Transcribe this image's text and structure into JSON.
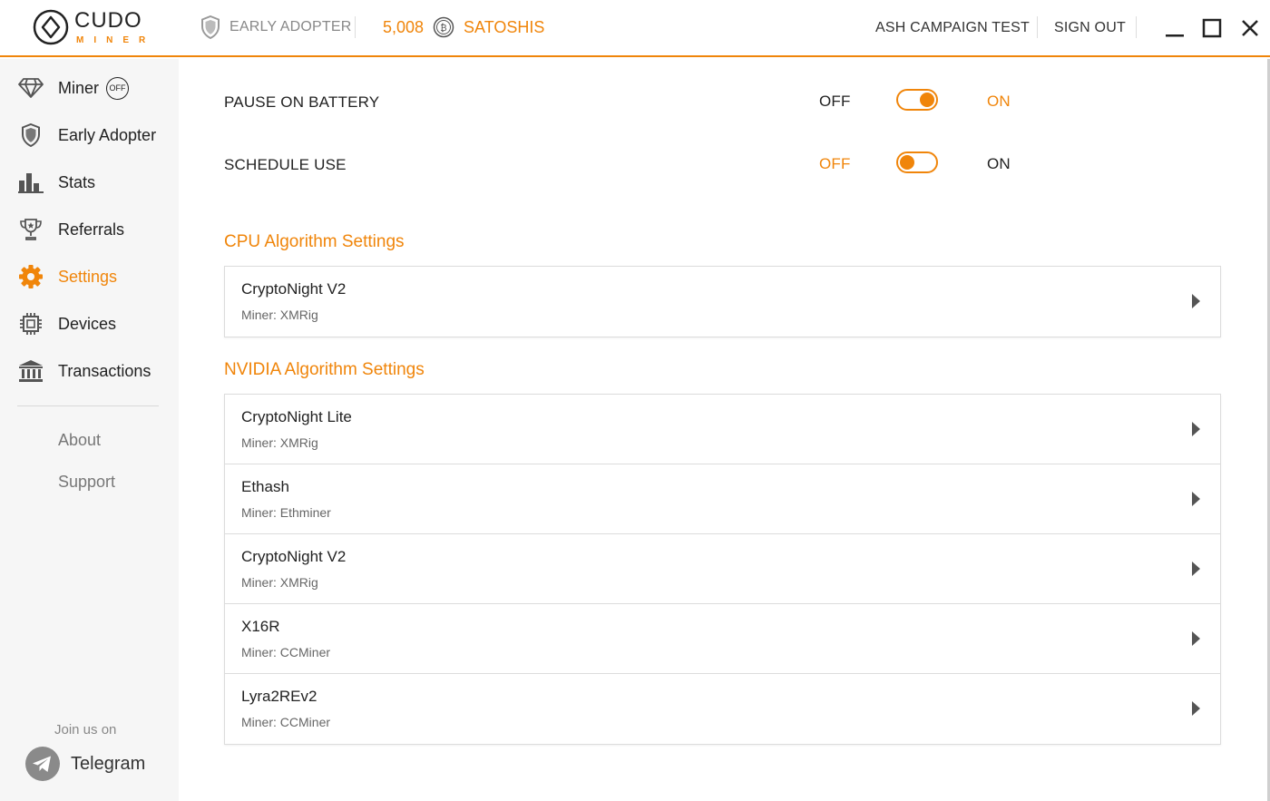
{
  "header": {
    "logo_word": "CUDO",
    "logo_sub": "MINER",
    "badge_label": "EARLY ADOPTER",
    "balance_value": "5,008",
    "balance_unit": "SATOSHIS",
    "campaign": "ASH CAMPAIGN TEST",
    "sign_out": "SIGN OUT"
  },
  "sidebar": {
    "items": [
      {
        "label": "Miner",
        "icon": "diamond-icon",
        "status": "OFF"
      },
      {
        "label": "Early Adopter",
        "icon": "shield-icon"
      },
      {
        "label": "Stats",
        "icon": "bar-chart-icon"
      },
      {
        "label": "Referrals",
        "icon": "trophy-icon"
      },
      {
        "label": "Settings",
        "icon": "gear-icon",
        "active": true
      },
      {
        "label": "Devices",
        "icon": "chip-icon"
      },
      {
        "label": "Transactions",
        "icon": "bank-icon"
      }
    ],
    "about": "About",
    "support": "Support",
    "join": "Join us on",
    "telegram": "Telegram"
  },
  "settings": {
    "pause_on_battery": {
      "label": "PAUSE ON BATTERY",
      "off": "OFF",
      "on": "ON",
      "value": "ON"
    },
    "schedule_use": {
      "label": "SCHEDULE USE",
      "off": "OFF",
      "on": "ON",
      "value": "OFF"
    }
  },
  "cpu": {
    "title": "CPU Algorithm Settings",
    "algorithms": [
      {
        "name": "CryptoNight V2",
        "miner": "Miner: XMRig"
      }
    ]
  },
  "nvidia": {
    "title": "NVIDIA Algorithm Settings",
    "algorithms": [
      {
        "name": "CryptoNight Lite",
        "miner": "Miner: XMRig"
      },
      {
        "name": "Ethash",
        "miner": "Miner: Ethminer"
      },
      {
        "name": "CryptoNight V2",
        "miner": "Miner: XMRig"
      },
      {
        "name": "X16R",
        "miner": "Miner: CCMiner"
      },
      {
        "name": "Lyra2REv2",
        "miner": "Miner: CCMiner"
      }
    ]
  },
  "colors": {
    "accent": "#f0850a",
    "sidebar_bg": "#f6f6f6",
    "text": "#222222"
  }
}
